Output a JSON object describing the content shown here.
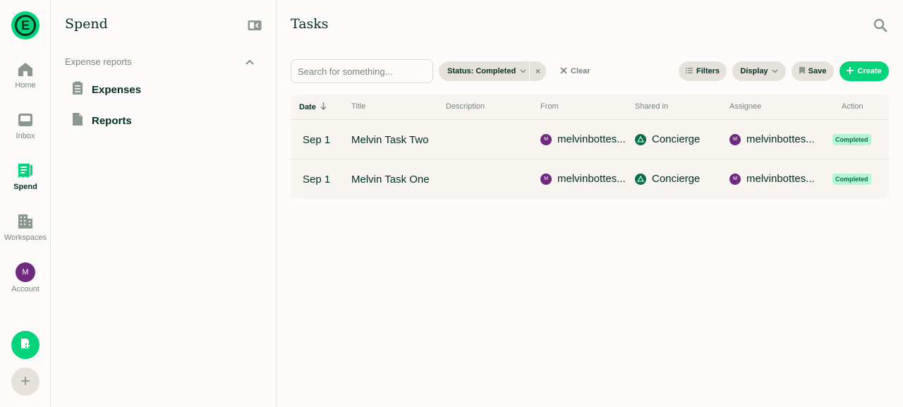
{
  "rail": {
    "items": [
      {
        "label": "Home"
      },
      {
        "label": "Inbox"
      },
      {
        "label": "Spend"
      },
      {
        "label": "Workspaces"
      },
      {
        "label": "Account"
      }
    ],
    "account_initial": "M",
    "logo_letter": "E",
    "add_symbol": "+"
  },
  "sidebar": {
    "title": "Spend",
    "section": "Expense reports",
    "items": [
      {
        "label": "Expenses"
      },
      {
        "label": "Reports"
      }
    ]
  },
  "main": {
    "title": "Tasks",
    "search_placeholder": "Search for something...",
    "status_filter": "Status: Completed",
    "remove_symbol": "×",
    "clear_label": "Clear",
    "filters_label": "Filters",
    "display_label": "Display",
    "save_label": "Save",
    "create_label": "Create",
    "columns": [
      "Date",
      "Title",
      "Description",
      "From",
      "Shared in",
      "Assignee",
      "Action"
    ],
    "rows": [
      {
        "date": "Sep 1",
        "title": "Melvin Task Two",
        "description": "",
        "from": "melvinbottes...",
        "from_initial": "M",
        "shared_in": "Concierge",
        "assignee": "melvinbottes...",
        "assignee_initial": "M",
        "action": "Completed"
      },
      {
        "date": "Sep 1",
        "title": "Melvin Task One",
        "description": "",
        "from": "melvinbottes...",
        "from_initial": "M",
        "shared_in": "Concierge",
        "assignee": "melvinbottes...",
        "assignee_initial": "M",
        "action": "Completed"
      }
    ]
  },
  "colors": {
    "accent": "#03d47c",
    "text": "#002e22",
    "muted": "#76847e",
    "avatar": "#6f2a7d",
    "badge_bg": "#b5f5d6"
  }
}
